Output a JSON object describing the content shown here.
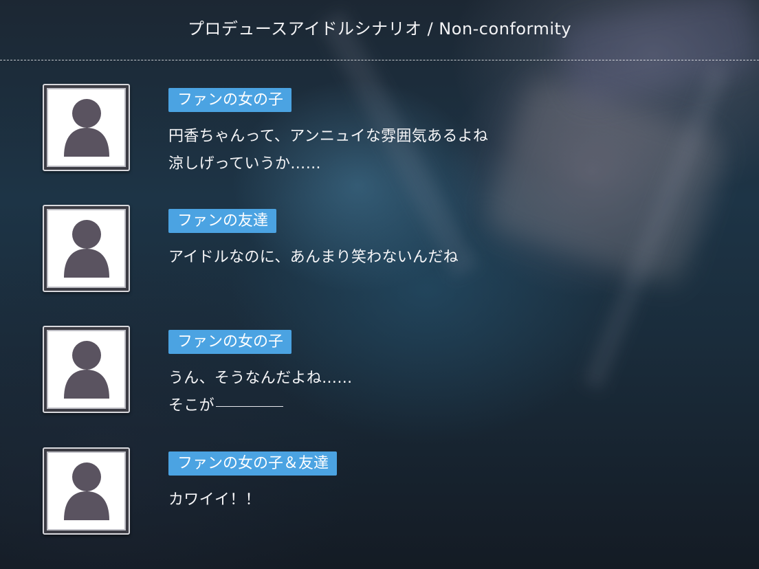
{
  "header": {
    "title": "プロデュースアイドルシナリオ / Non-conformity"
  },
  "entries": [
    {
      "speaker": "ファンの女の子",
      "lines": [
        "円香ちゃんって、アンニュイな雰囲気あるよね",
        "涼しげっていうか……"
      ]
    },
    {
      "speaker": "ファンの友達",
      "lines": [
        "アイドルなのに、あんまり笑わないんだね"
      ]
    },
    {
      "speaker": "ファンの女の子",
      "lines": [
        "うん、そうなんだよね……",
        "そこが"
      ]
    },
    {
      "speaker": "ファンの女の子＆友達",
      "lines": [
        "カワイイ！！"
      ]
    }
  ],
  "colors": {
    "speaker_tag": "#4ba3e2",
    "avatar_silhouette": "#5a5360"
  },
  "icons": {
    "avatar": "person-silhouette-icon"
  }
}
